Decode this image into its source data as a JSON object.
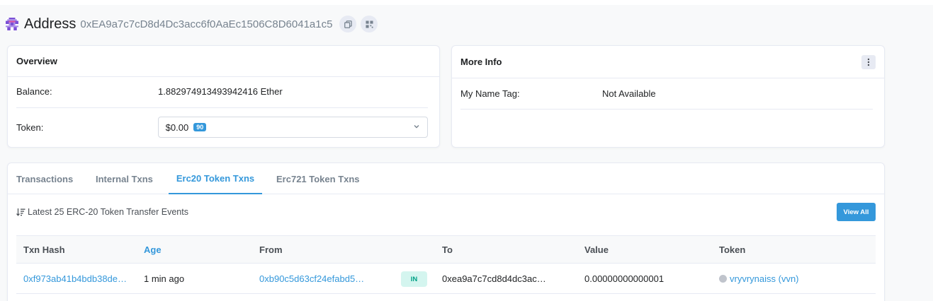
{
  "header": {
    "title": "Address",
    "address": "0xEA9a7c7cD8d4Dc3acc6f0AaEc1506C8D6041a1c5"
  },
  "overview": {
    "title": "Overview",
    "balance_label": "Balance:",
    "balance_value": "1.882974913493942416 Ether",
    "token_label": "Token:",
    "token_value": "$0.00",
    "token_count": "90"
  },
  "more_info": {
    "title": "More Info",
    "name_tag_label": "My Name Tag:",
    "name_tag_value": "Not Available"
  },
  "tabs": [
    {
      "label": "Transactions",
      "active": false
    },
    {
      "label": "Internal Txns",
      "active": false
    },
    {
      "label": "Erc20 Token Txns",
      "active": true
    },
    {
      "label": "Erc721 Token Txns",
      "active": false
    }
  ],
  "token_txns": {
    "summary": "Latest 25 ERC-20 Token Transfer Events",
    "view_all_label": "View All",
    "columns": [
      "Txn Hash",
      "Age",
      "From",
      "To",
      "Value",
      "Token"
    ],
    "rows": [
      {
        "txn_hash": "0xf973ab41b4bdb38de…",
        "age": "1 min ago",
        "from": "0xb90c5d63cf24efabd5…",
        "direction": "IN",
        "to": "0xea9a7c7cd8d4dc3ac…",
        "value": "0.00000000000001",
        "token": "vryvrynaiss (vvn)"
      }
    ]
  },
  "colors": {
    "accent": "#3498db",
    "in_badge_bg": "#d4f5ef",
    "in_badge_text": "#00a186"
  }
}
